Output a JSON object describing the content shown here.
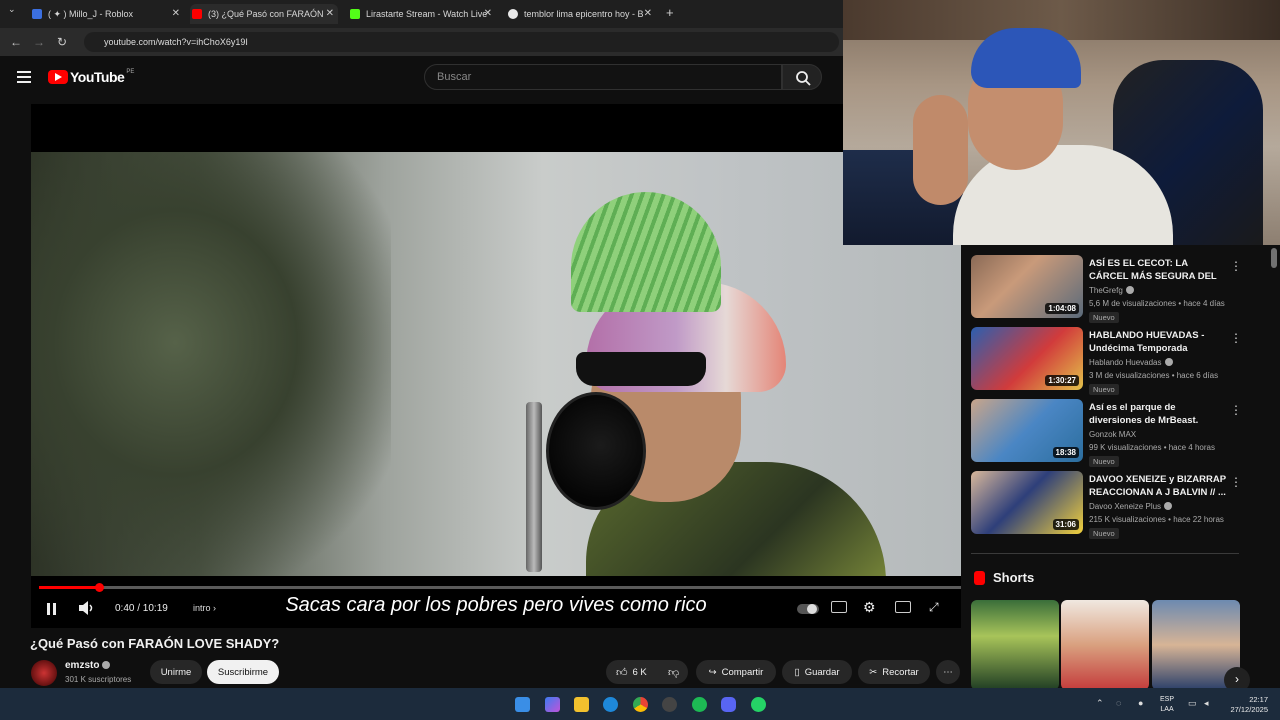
{
  "browser": {
    "tabs": [
      {
        "label": "( ✦ ) Millo_J - Roblox",
        "favicon_color": "#3b6fe0"
      },
      {
        "label": "(3) ¿Qué Pasó con FARAÓN",
        "favicon_color": "#ff0000"
      },
      {
        "label": "Lirastarte Stream - Watch Live",
        "favicon_color": "#53fc18"
      },
      {
        "label": "temblor lima epicentro hoy - B",
        "favicon_color": "#e8e8e8"
      }
    ],
    "url": "youtube.com/watch?v=ihChoX6y19I",
    "new_tab_label": "+"
  },
  "youtube": {
    "logo_text": "YouTube",
    "country_code": "PE",
    "search_placeholder": "Buscar"
  },
  "player": {
    "current_time": "0:40",
    "duration": "10:19",
    "time_display": "0:40 / 10:19",
    "chapter": "intro",
    "subtitle": "Sacas cara por los pobres pero vives como rico",
    "progress_fraction": 0.065
  },
  "video": {
    "title": "¿Qué Pasó con FARAÓN LOVE SHADY?",
    "channel": "emzsto",
    "subscribers": "301 K suscriptores",
    "join_label": "Unirme",
    "subscribe_label": "Suscribirme",
    "likes": "6 K",
    "share_label": "Compartir",
    "save_label": "Guardar",
    "clip_label": "Recortar"
  },
  "recommendations": [
    {
      "title": "ASÍ ES EL CECOT: LA CÁRCEL MÁS SEGURA DEL MUNDO",
      "channel": "TheGrefg",
      "verified": true,
      "views": "5,6 M de visualizaciones",
      "age": "hace 4 días",
      "badge": "Nuevo",
      "duration": "1:04:08"
    },
    {
      "title": "HABLANDO HUEVADAS - Undécima Temporada [SEÑOR...",
      "channel": "Hablando Huevadas",
      "verified": true,
      "views": "3 M de visualizaciones",
      "age": "hace 6 días",
      "badge": "Nuevo",
      "duration": "1:30:27"
    },
    {
      "title": "Así es el parque de diversiones de MrBeast.",
      "channel": "Gonzok MAX",
      "verified": false,
      "views": "99 K visualizaciones",
      "age": "hace 4 horas",
      "badge": "Nuevo",
      "duration": "18:38"
    },
    {
      "title": "DAVOO XENEIZE y BIZARRAP REACCIONAN A J BALVIN // ...",
      "channel": "Davoo Xeneize Plus",
      "verified": true,
      "views": "215 K visualizaciones",
      "age": "hace 22 horas",
      "badge": "Nuevo",
      "duration": "31:06"
    }
  ],
  "shorts": {
    "label": "Shorts"
  },
  "taskbar": {
    "lang_line1": "ESP",
    "lang_line2": "LAA",
    "time": "22:17",
    "date": "27/12/2025"
  }
}
